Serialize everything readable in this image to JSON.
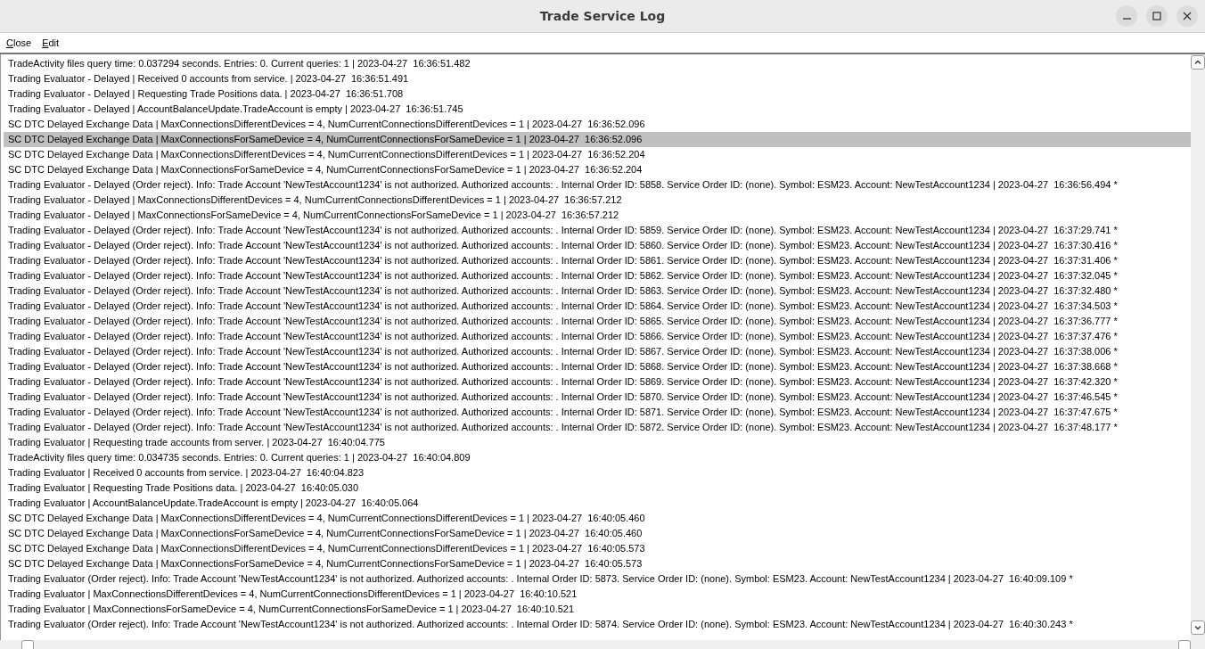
{
  "window": {
    "title": "Trade Service Log"
  },
  "menu": [
    {
      "label": "Close"
    },
    {
      "label": "Edit"
    }
  ],
  "log": [
    {
      "text": "TradeActivity files query time: 0.037294 seconds. Entries: 0. Current queries: 1 | 2023-04-27  16:36:51.482",
      "selected": false
    },
    {
      "text": "Trading Evaluator - Delayed | Received 0 accounts from service. | 2023-04-27  16:36:51.491",
      "selected": false
    },
    {
      "text": "Trading Evaluator - Delayed | Requesting Trade Positions data. | 2023-04-27  16:36:51.708",
      "selected": false
    },
    {
      "text": "Trading Evaluator - Delayed | AccountBalanceUpdate.TradeAccount is empty | 2023-04-27  16:36:51.745",
      "selected": false
    },
    {
      "text": "SC DTC Delayed Exchange Data | MaxConnectionsDifferentDevices = 4, NumCurrentConnectionsDifferentDevices = 1 | 2023-04-27  16:36:52.096",
      "selected": false
    },
    {
      "text": "SC DTC Delayed Exchange Data | MaxConnectionsForSameDevice = 4, NumCurrentConnectionsForSameDevice = 1 | 2023-04-27  16:36:52.096",
      "selected": true
    },
    {
      "text": "SC DTC Delayed Exchange Data | MaxConnectionsDifferentDevices = 4, NumCurrentConnectionsDifferentDevices = 1 | 2023-04-27  16:36:52.204",
      "selected": false
    },
    {
      "text": "SC DTC Delayed Exchange Data | MaxConnectionsForSameDevice = 4, NumCurrentConnectionsForSameDevice = 1 | 2023-04-27  16:36:52.204",
      "selected": false
    },
    {
      "text": "Trading Evaluator - Delayed (Order reject). Info: Trade Account 'NewTestAccount1234' is not authorized. Authorized accounts: . Internal Order ID: 5858. Service Order ID: (none). Symbol: ESM23. Account: NewTestAccount1234 | 2023-04-27  16:36:56.494 *",
      "selected": false
    },
    {
      "text": "Trading Evaluator - Delayed | MaxConnectionsDifferentDevices = 4, NumCurrentConnectionsDifferentDevices = 1 | 2023-04-27  16:36:57.212",
      "selected": false
    },
    {
      "text": "Trading Evaluator - Delayed | MaxConnectionsForSameDevice = 4, NumCurrentConnectionsForSameDevice = 1 | 2023-04-27  16:36:57.212",
      "selected": false
    },
    {
      "text": "Trading Evaluator - Delayed (Order reject). Info: Trade Account 'NewTestAccount1234' is not authorized. Authorized accounts: . Internal Order ID: 5859. Service Order ID: (none). Symbol: ESM23. Account: NewTestAccount1234 | 2023-04-27  16:37:29.741 *",
      "selected": false
    },
    {
      "text": "Trading Evaluator - Delayed (Order reject). Info: Trade Account 'NewTestAccount1234' is not authorized. Authorized accounts: . Internal Order ID: 5860. Service Order ID: (none). Symbol: ESM23. Account: NewTestAccount1234 | 2023-04-27  16:37:30.416 *",
      "selected": false
    },
    {
      "text": "Trading Evaluator - Delayed (Order reject). Info: Trade Account 'NewTestAccount1234' is not authorized. Authorized accounts: . Internal Order ID: 5861. Service Order ID: (none). Symbol: ESM23. Account: NewTestAccount1234 | 2023-04-27  16:37:31.406 *",
      "selected": false
    },
    {
      "text": "Trading Evaluator - Delayed (Order reject). Info: Trade Account 'NewTestAccount1234' is not authorized. Authorized accounts: . Internal Order ID: 5862. Service Order ID: (none). Symbol: ESM23. Account: NewTestAccount1234 | 2023-04-27  16:37:32.045 *",
      "selected": false
    },
    {
      "text": "Trading Evaluator - Delayed (Order reject). Info: Trade Account 'NewTestAccount1234' is not authorized. Authorized accounts: . Internal Order ID: 5863. Service Order ID: (none). Symbol: ESM23. Account: NewTestAccount1234 | 2023-04-27  16:37:32.480 *",
      "selected": false
    },
    {
      "text": "Trading Evaluator - Delayed (Order reject). Info: Trade Account 'NewTestAccount1234' is not authorized. Authorized accounts: . Internal Order ID: 5864. Service Order ID: (none). Symbol: ESM23. Account: NewTestAccount1234 | 2023-04-27  16:37:34.503 *",
      "selected": false
    },
    {
      "text": "Trading Evaluator - Delayed (Order reject). Info: Trade Account 'NewTestAccount1234' is not authorized. Authorized accounts: . Internal Order ID: 5865. Service Order ID: (none). Symbol: ESM23. Account: NewTestAccount1234 | 2023-04-27  16:37:36.777 *",
      "selected": false
    },
    {
      "text": "Trading Evaluator - Delayed (Order reject). Info: Trade Account 'NewTestAccount1234' is not authorized. Authorized accounts: . Internal Order ID: 5866. Service Order ID: (none). Symbol: ESM23. Account: NewTestAccount1234 | 2023-04-27  16:37:37.476 *",
      "selected": false
    },
    {
      "text": "Trading Evaluator - Delayed (Order reject). Info: Trade Account 'NewTestAccount1234' is not authorized. Authorized accounts: . Internal Order ID: 5867. Service Order ID: (none). Symbol: ESM23. Account: NewTestAccount1234 | 2023-04-27  16:37:38.006 *",
      "selected": false
    },
    {
      "text": "Trading Evaluator - Delayed (Order reject). Info: Trade Account 'NewTestAccount1234' is not authorized. Authorized accounts: . Internal Order ID: 5868. Service Order ID: (none). Symbol: ESM23. Account: NewTestAccount1234 | 2023-04-27  16:37:38.668 *",
      "selected": false
    },
    {
      "text": "Trading Evaluator - Delayed (Order reject). Info: Trade Account 'NewTestAccount1234' is not authorized. Authorized accounts: . Internal Order ID: 5869. Service Order ID: (none). Symbol: ESM23. Account: NewTestAccount1234 | 2023-04-27  16:37:42.320 *",
      "selected": false
    },
    {
      "text": "Trading Evaluator - Delayed (Order reject). Info: Trade Account 'NewTestAccount1234' is not authorized. Authorized accounts: . Internal Order ID: 5870. Service Order ID: (none). Symbol: ESM23. Account: NewTestAccount1234 | 2023-04-27  16:37:46.545 *",
      "selected": false
    },
    {
      "text": "Trading Evaluator - Delayed (Order reject). Info: Trade Account 'NewTestAccount1234' is not authorized. Authorized accounts: . Internal Order ID: 5871. Service Order ID: (none). Symbol: ESM23. Account: NewTestAccount1234 | 2023-04-27  16:37:47.675 *",
      "selected": false
    },
    {
      "text": "Trading Evaluator - Delayed (Order reject). Info: Trade Account 'NewTestAccount1234' is not authorized. Authorized accounts: . Internal Order ID: 5872. Service Order ID: (none). Symbol: ESM23. Account: NewTestAccount1234 | 2023-04-27  16:37:48.177 *",
      "selected": false
    },
    {
      "text": "Trading Evaluator | Requesting trade accounts from server. | 2023-04-27  16:40:04.775",
      "selected": false
    },
    {
      "text": "TradeActivity files query time: 0.034735 seconds. Entries: 0. Current queries: 1 | 2023-04-27  16:40:04.809",
      "selected": false
    },
    {
      "text": "Trading Evaluator | Received 0 accounts from service. | 2023-04-27  16:40:04.823",
      "selected": false
    },
    {
      "text": "Trading Evaluator | Requesting Trade Positions data. | 2023-04-27  16:40:05.030",
      "selected": false
    },
    {
      "text": "Trading Evaluator | AccountBalanceUpdate.TradeAccount is empty | 2023-04-27  16:40:05.064",
      "selected": false
    },
    {
      "text": "SC DTC Delayed Exchange Data | MaxConnectionsDifferentDevices = 4, NumCurrentConnectionsDifferentDevices = 1 | 2023-04-27  16:40:05.460",
      "selected": false
    },
    {
      "text": "SC DTC Delayed Exchange Data | MaxConnectionsForSameDevice = 4, NumCurrentConnectionsForSameDevice = 1 | 2023-04-27  16:40:05.460",
      "selected": false
    },
    {
      "text": "SC DTC Delayed Exchange Data | MaxConnectionsDifferentDevices = 4, NumCurrentConnectionsDifferentDevices = 1 | 2023-04-27  16:40:05.573",
      "selected": false
    },
    {
      "text": "SC DTC Delayed Exchange Data | MaxConnectionsForSameDevice = 4, NumCurrentConnectionsForSameDevice = 1 | 2023-04-27  16:40:05.573",
      "selected": false
    },
    {
      "text": "Trading Evaluator (Order reject). Info: Trade Account 'NewTestAccount1234' is not authorized. Authorized accounts: . Internal Order ID: 5873. Service Order ID: (none). Symbol: ESM23. Account: NewTestAccount1234 | 2023-04-27  16:40:09.109 *",
      "selected": false
    },
    {
      "text": "Trading Evaluator | MaxConnectionsDifferentDevices = 4, NumCurrentConnectionsDifferentDevices = 1 | 2023-04-27  16:40:10.521",
      "selected": false
    },
    {
      "text": "Trading Evaluator | MaxConnectionsForSameDevice = 4, NumCurrentConnectionsForSameDevice = 1 | 2023-04-27  16:40:10.521",
      "selected": false
    },
    {
      "text": "Trading Evaluator (Order reject). Info: Trade Account 'NewTestAccount1234' is not authorized. Authorized accounts: . Internal Order ID: 5874. Service Order ID: (none). Symbol: ESM23. Account: NewTestAccount1234 | 2023-04-27  16:40:30.243 *",
      "selected": false
    }
  ]
}
